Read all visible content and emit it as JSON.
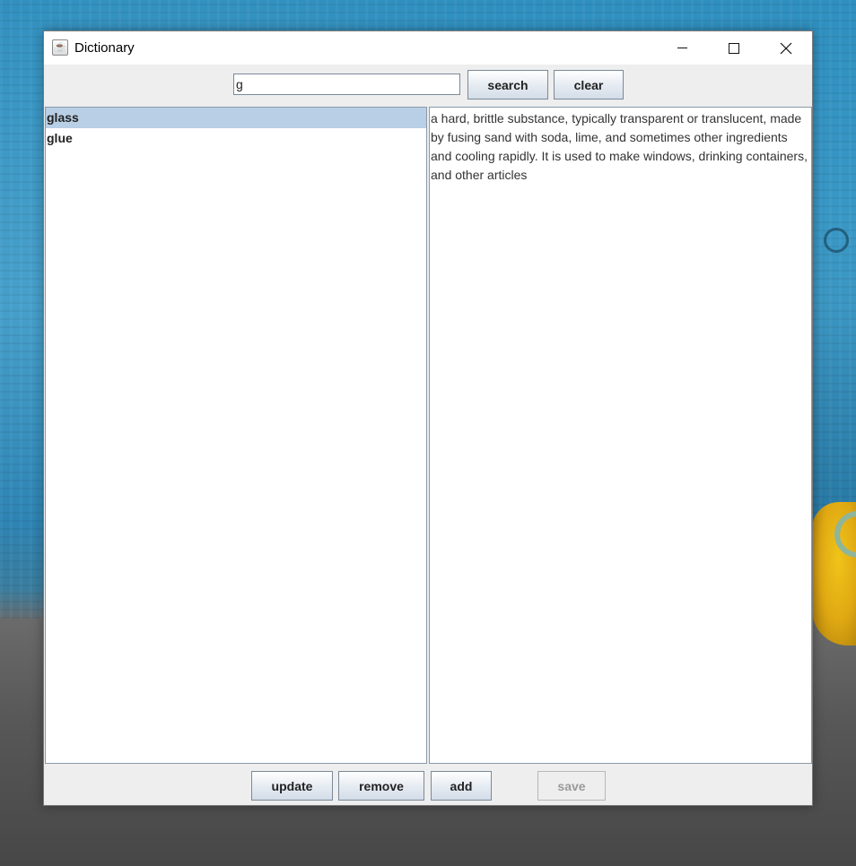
{
  "window": {
    "title": "Dictionary",
    "app_icon": "java-cup-icon"
  },
  "search": {
    "value": "g",
    "search_label": "search",
    "clear_label": "clear"
  },
  "word_list": {
    "items": [
      {
        "label": "glass",
        "selected": true
      },
      {
        "label": "glue",
        "selected": false
      }
    ]
  },
  "definition": {
    "text": "a hard, brittle substance, typically transparent or translucent, made by fusing sand with soda, lime, and sometimes other ingredients and cooling rapidly. It is used to make windows, drinking containers, and other articles"
  },
  "actions": {
    "update_label": "update",
    "remove_label": "remove",
    "add_label": "add",
    "save_label": "save",
    "save_enabled": false
  },
  "colors": {
    "selection": "#b8cfe5",
    "window_bg": "#eeeeee"
  }
}
